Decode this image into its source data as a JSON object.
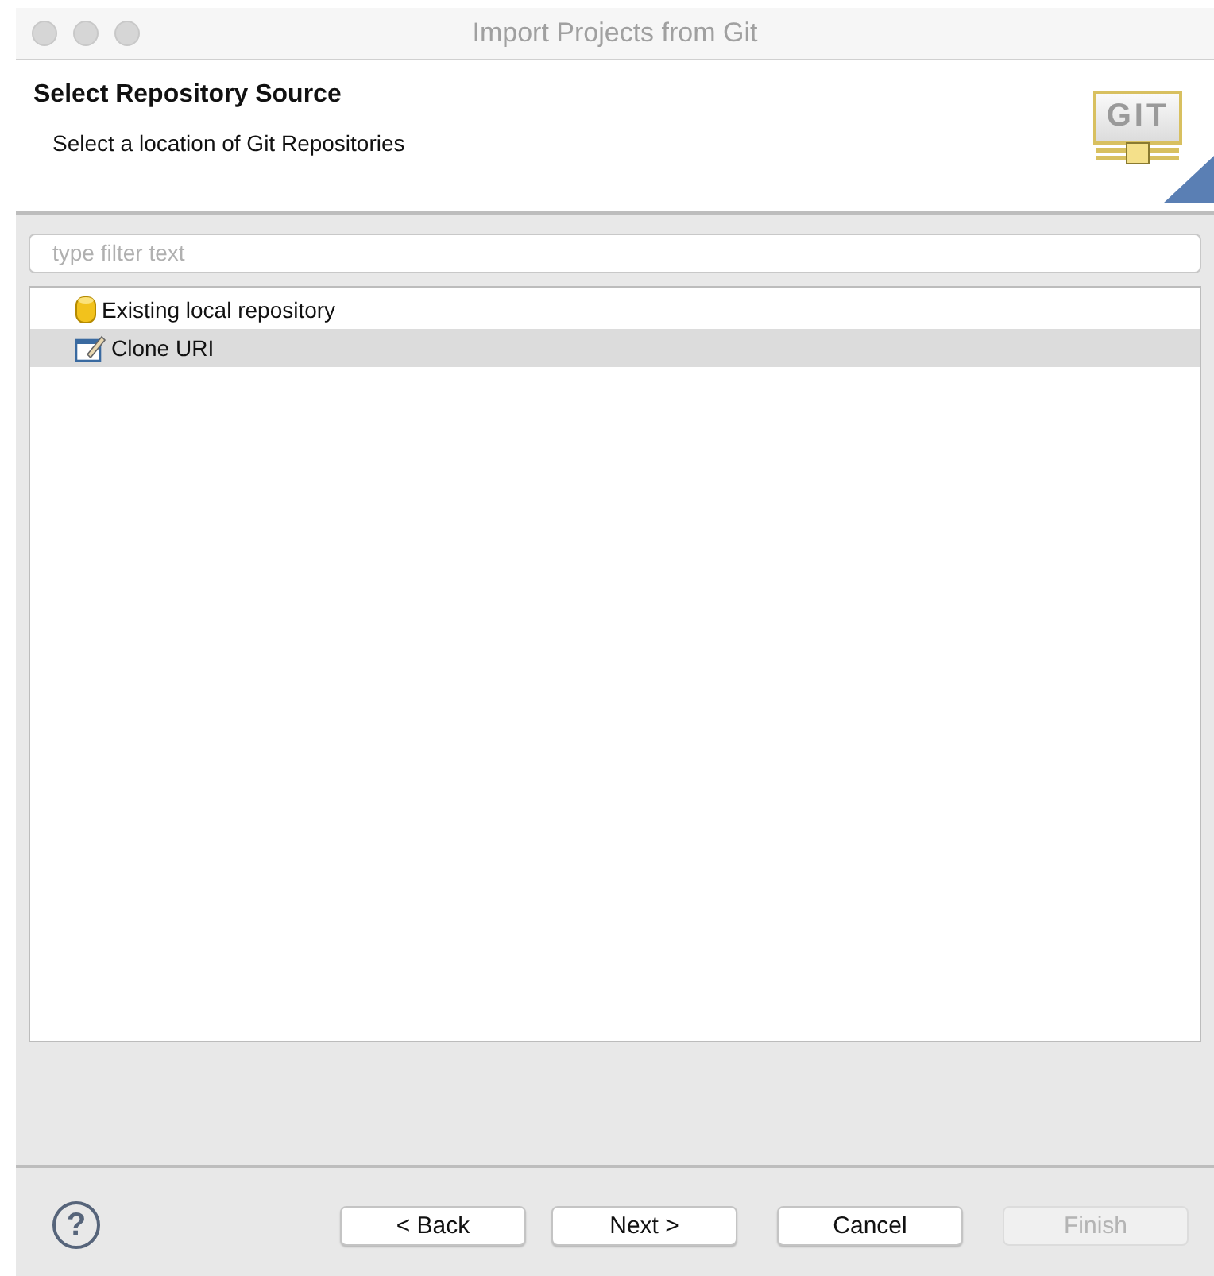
{
  "window": {
    "title": "Import Projects from Git"
  },
  "header": {
    "title": "Select Repository Source",
    "subtitle": "Select a location of Git Repositories",
    "logo": "GIT"
  },
  "filter": {
    "placeholder": "type filter text"
  },
  "items": [
    {
      "label": "Existing local repository",
      "kind": "repository",
      "selected": false
    },
    {
      "label": "Clone URI",
      "kind": "clone",
      "selected": true
    }
  ],
  "help": "?",
  "buttons": [
    {
      "label": "< Back",
      "disabled": false
    },
    {
      "label": "Next >",
      "disabled": false
    },
    {
      "label": "Cancel",
      "disabled": false
    },
    {
      "label": "Finish",
      "disabled": true
    }
  ]
}
